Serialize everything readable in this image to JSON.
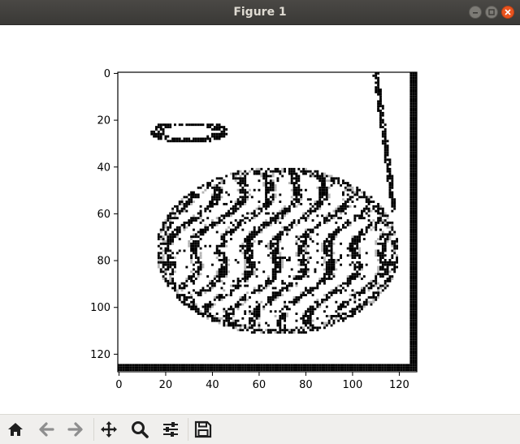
{
  "window": {
    "title": "Figure 1"
  },
  "title_buttons": {
    "minimize": "minimize-icon",
    "maximize": "maximize-icon",
    "close": "close-icon"
  },
  "toolbar": {
    "tools": [
      {
        "name": "home",
        "icon": "home-icon"
      },
      {
        "name": "back",
        "icon": "arrow-left-icon"
      },
      {
        "name": "forward",
        "icon": "arrow-right-icon"
      },
      {
        "name": "pan",
        "icon": "move-icon"
      },
      {
        "name": "zoom",
        "icon": "magnifier-icon"
      },
      {
        "name": "configure-subplots",
        "icon": "sliders-icon"
      },
      {
        "name": "save",
        "icon": "floppy-disk-icon"
      }
    ]
  },
  "chart_data": {
    "type": "heatmap",
    "title": "",
    "xlabel": "",
    "ylabel": "",
    "xlim": [
      0,
      127
    ],
    "ylim": [
      127,
      0
    ],
    "xticks": [
      "0",
      "20",
      "40",
      "60",
      "80",
      "100",
      "120"
    ],
    "yticks": [
      "0",
      "20",
      "40",
      "60",
      "80",
      "100",
      "120"
    ],
    "colormap": "gray",
    "colors": {
      "ink": "#000000",
      "mid": "#b4b4b4",
      "paper": "#ffffff"
    }
  }
}
